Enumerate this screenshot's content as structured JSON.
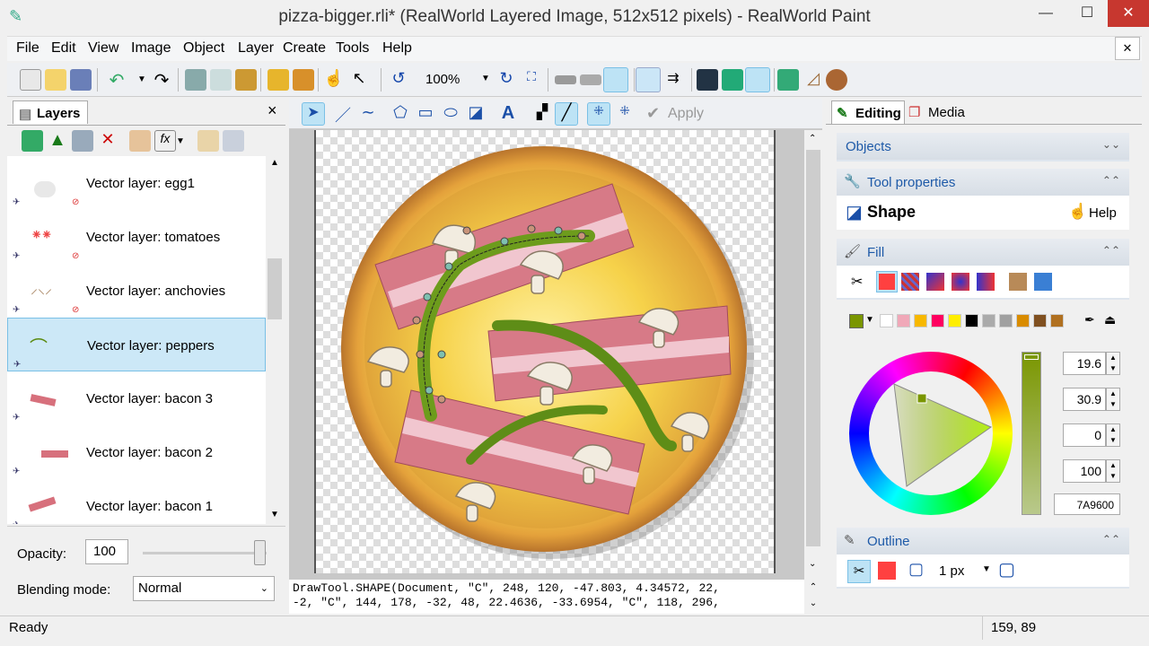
{
  "window": {
    "title": "pizza-bigger.rli* (RealWorld Layered Image, 512x512 pixels) - RealWorld Paint",
    "minimize": "—",
    "maximize": "☐",
    "close": "✕"
  },
  "menu": [
    "File",
    "Edit",
    "View",
    "Image",
    "Object",
    "Layer",
    "Create",
    "Tools",
    "Help"
  ],
  "toolbar": {
    "zoom": "100%"
  },
  "drawtools": {
    "apply_label": "Apply"
  },
  "layers_panel": {
    "tab_label": "Layers",
    "close": "×",
    "layers": [
      {
        "name": "Vector layer: egg1"
      },
      {
        "name": "Vector layer: tomatoes"
      },
      {
        "name": "Vector layer: anchovies"
      },
      {
        "name": "Vector layer: peppers",
        "selected": true
      },
      {
        "name": "Vector layer: bacon 3"
      },
      {
        "name": "Vector layer: bacon 2"
      },
      {
        "name": "Vector layer: bacon 1"
      }
    ],
    "opacity_label": "Opacity:",
    "opacity_value": "100",
    "blending_label": "Blending mode:",
    "blending_value": "Normal"
  },
  "console": {
    "line1": "DrawTool.SHAPE(Document, \"C\", 248, 120, -47.803, 4.34572, 22,",
    "line2": "-2, \"C\", 144, 178, -32, 48, 22.4636, -33.6954, \"C\", 118, 296,"
  },
  "right_panel": {
    "tabs": [
      {
        "label": "Editing",
        "active": true
      },
      {
        "label": "Media",
        "active": false
      }
    ],
    "objects_label": "Objects",
    "tool_properties_label": "Tool properties",
    "tool_name": "Shape",
    "help_label": "Help",
    "fill_label": "Fill",
    "outline_label": "Outline",
    "outline_width": "1 px",
    "hsv": {
      "h": "19.6",
      "s": "30.9",
      "v": "0",
      "a": "100"
    },
    "hex": "7A9600",
    "colors": {
      "fill_current": "#7a9600",
      "fill_red": "#ff4040",
      "outline_red": "#ff4040"
    },
    "palette": [
      "#ffffff",
      "#f0a8b8",
      "#f7b800",
      "#ff0060",
      "#ffee00",
      "#000000",
      "#aaaaaa",
      "#a0a0a0",
      "#d98c00",
      "#805020",
      "#b07020"
    ]
  },
  "status": {
    "left": "Ready",
    "coords": "159, 89"
  }
}
